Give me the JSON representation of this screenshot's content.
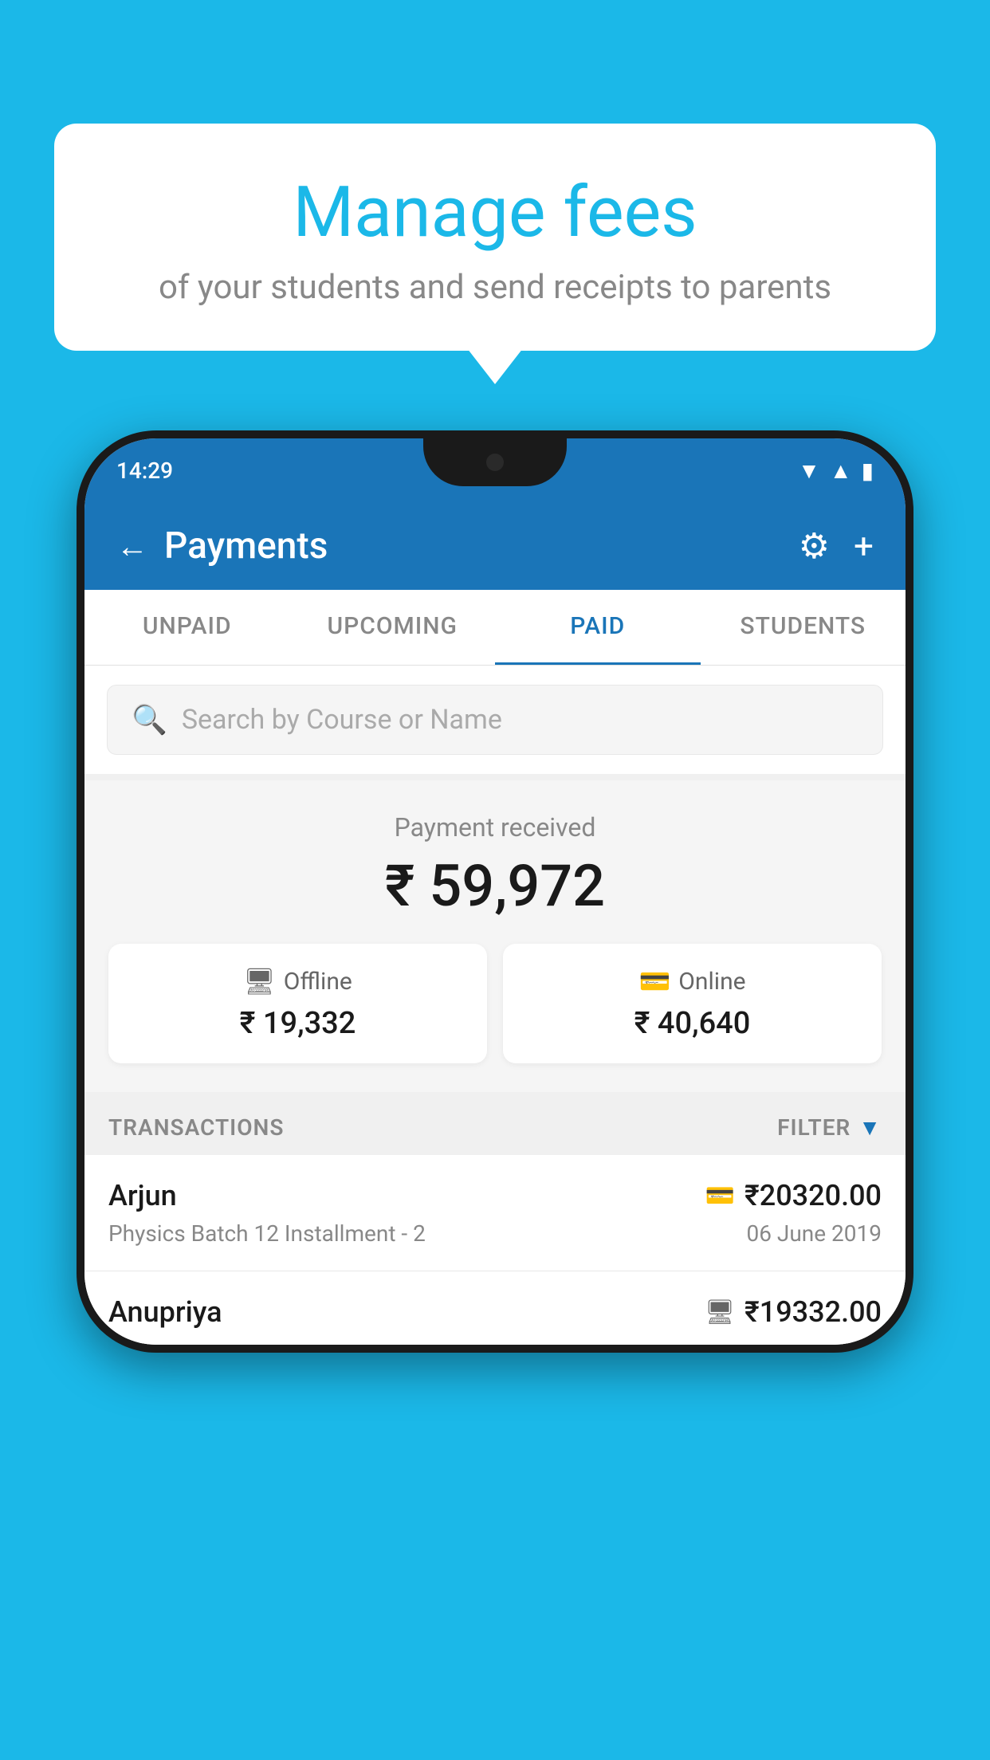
{
  "background_color": "#1BB8E8",
  "bubble": {
    "heading": "Manage fees",
    "subtext": "of your students and send receipts to parents"
  },
  "phone": {
    "status_bar": {
      "time": "14:29",
      "icons": [
        "wifi",
        "signal",
        "battery"
      ]
    },
    "header": {
      "title": "Payments",
      "back_label": "←",
      "settings_label": "⚙",
      "add_label": "+"
    },
    "tabs": [
      {
        "label": "UNPAID",
        "active": false
      },
      {
        "label": "UPCOMING",
        "active": false
      },
      {
        "label": "PAID",
        "active": true
      },
      {
        "label": "STUDENTS",
        "active": false
      }
    ],
    "search": {
      "placeholder": "Search by Course or Name"
    },
    "payment_received": {
      "label": "Payment received",
      "total": "₹ 59,972",
      "offline": {
        "label": "Offline",
        "amount": "₹ 19,332"
      },
      "online": {
        "label": "Online",
        "amount": "₹ 40,640"
      }
    },
    "transactions": {
      "header_label": "TRANSACTIONS",
      "filter_label": "FILTER",
      "rows": [
        {
          "name": "Arjun",
          "detail": "Physics Batch 12 Installment - 2",
          "amount": "₹20320.00",
          "date": "06 June 2019",
          "type": "online"
        },
        {
          "name": "Anupriya",
          "detail": "",
          "amount": "₹19332.00",
          "date": "",
          "type": "offline"
        }
      ]
    }
  }
}
